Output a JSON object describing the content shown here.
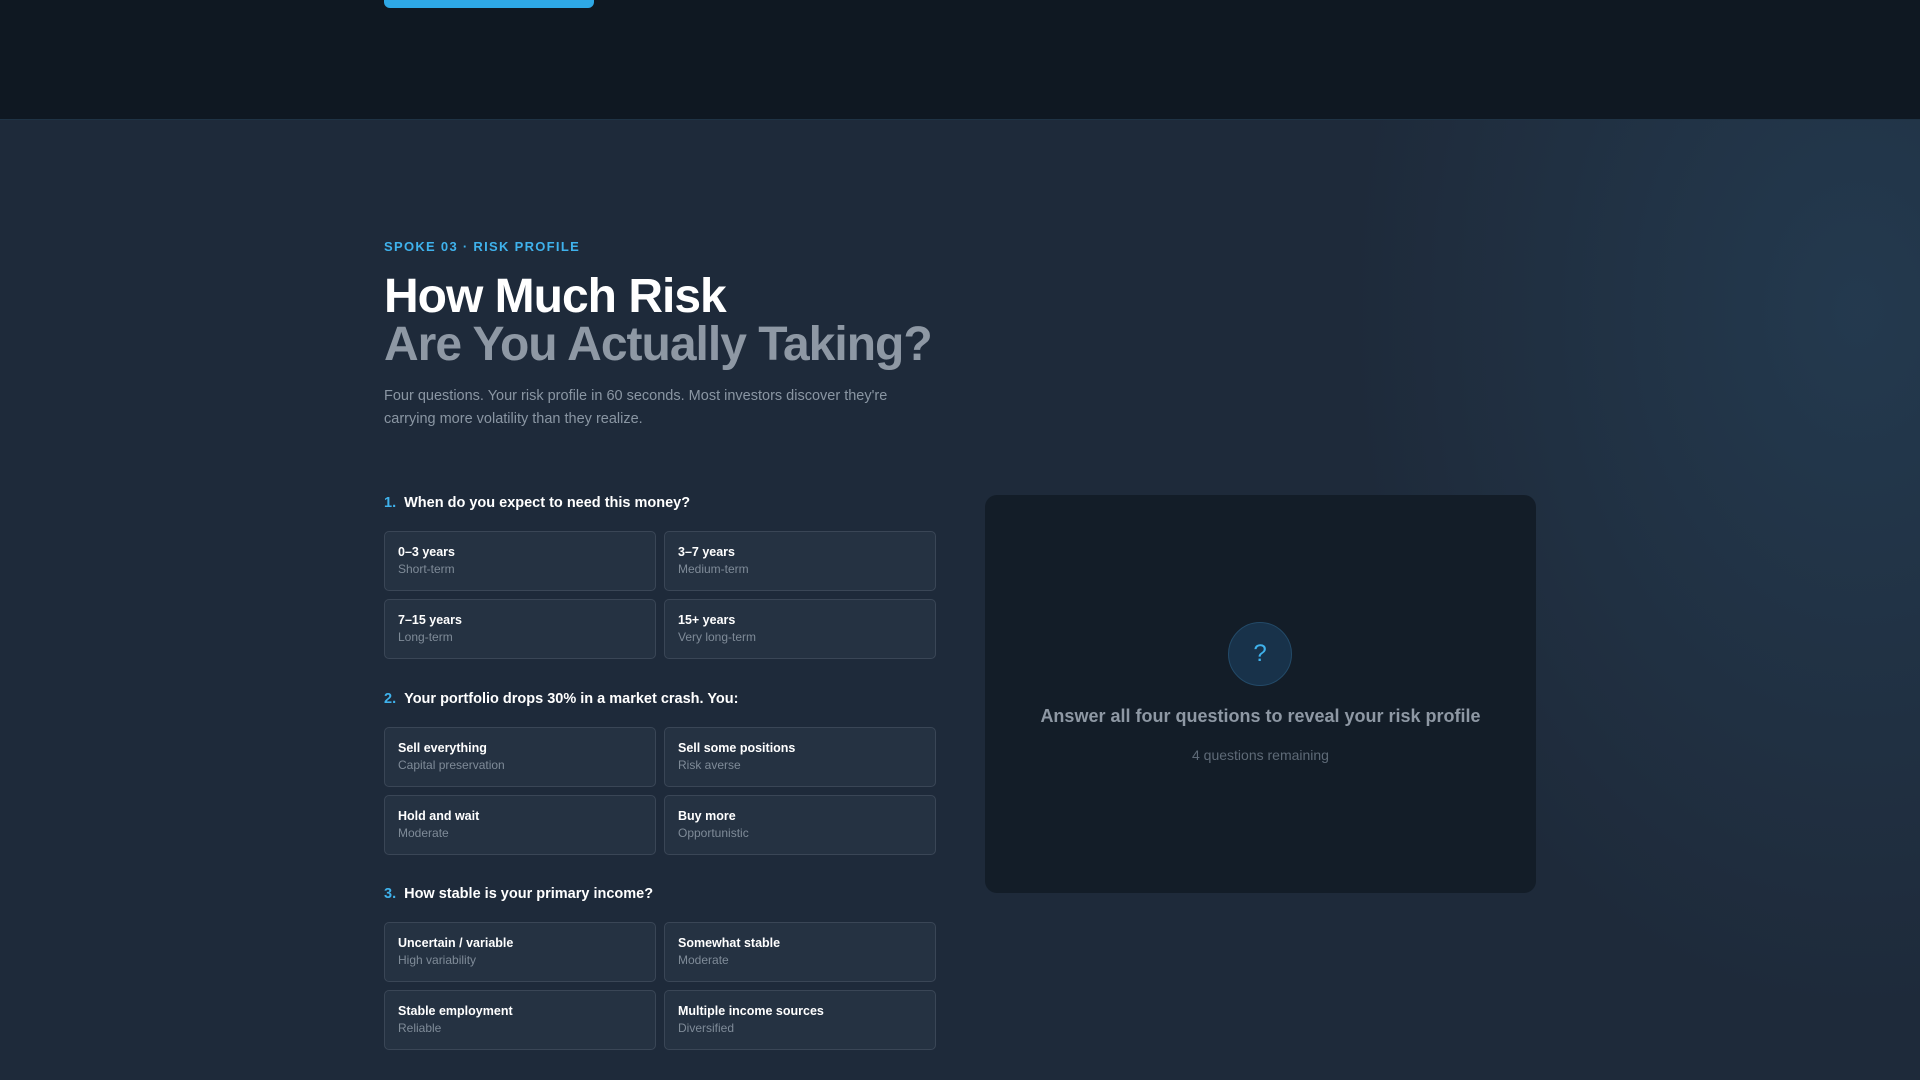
{
  "eyebrow": "SPOKE 03 · RISK PROFILE",
  "title_line1": "How Much Risk",
  "title_line2": "Are You Actually Taking?",
  "lede": "Four questions. Your risk profile in 60 seconds. Most investors discover they're carrying more volatility than they realize.",
  "questions": [
    {
      "number": "1.",
      "text": "When do you expect to need this money?",
      "options": [
        {
          "label": "0–3 years",
          "sub": "Short-term"
        },
        {
          "label": "3–7 years",
          "sub": "Medium-term"
        },
        {
          "label": "7–15 years",
          "sub": "Long-term"
        },
        {
          "label": "15+ years",
          "sub": "Very long-term"
        }
      ]
    },
    {
      "number": "2.",
      "text": "Your portfolio drops 30% in a market crash. You:",
      "options": [
        {
          "label": "Sell everything",
          "sub": "Capital preservation"
        },
        {
          "label": "Sell some positions",
          "sub": "Risk averse"
        },
        {
          "label": "Hold and wait",
          "sub": "Moderate"
        },
        {
          "label": "Buy more",
          "sub": "Opportunistic"
        }
      ]
    },
    {
      "number": "3.",
      "text": "How stable is your primary income?",
      "options": [
        {
          "label": "Uncertain / variable",
          "sub": "High variability"
        },
        {
          "label": "Somewhat stable",
          "sub": "Moderate"
        },
        {
          "label": "Stable employment",
          "sub": "Reliable"
        },
        {
          "label": "Multiple income sources",
          "sub": "Diversified"
        }
      ]
    }
  ],
  "result": {
    "icon": "?",
    "title": "Answer all four questions to reveal your risk profile",
    "remaining": "4 questions remaining"
  },
  "colors": {
    "accent": "#3fb2ec",
    "background": "#1e2a3a",
    "top_band": "#0f1822",
    "card": "#131d28"
  }
}
